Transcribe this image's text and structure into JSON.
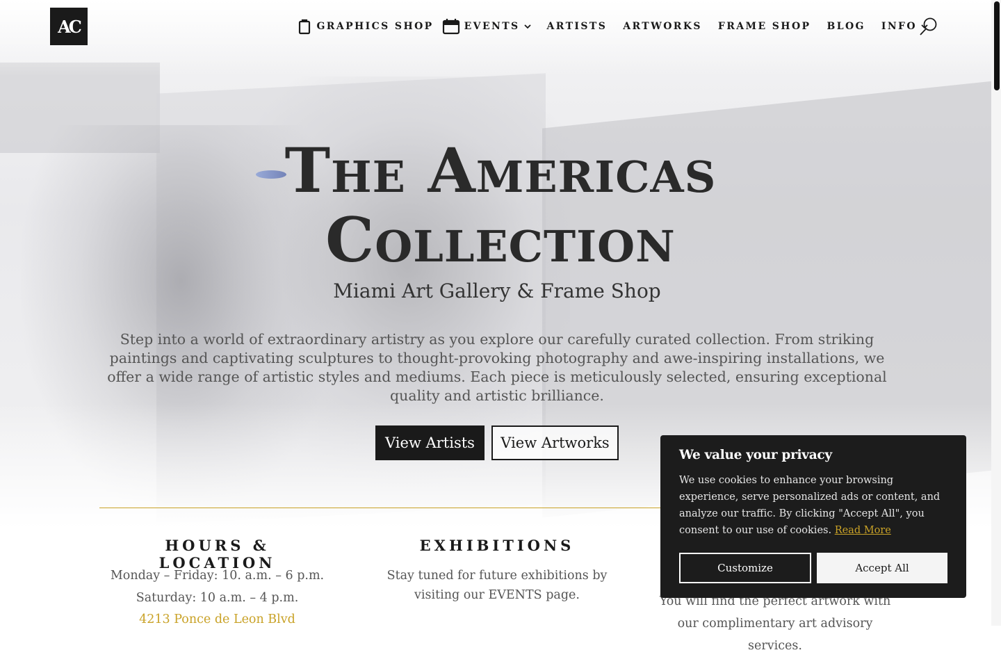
{
  "brand": {
    "logo_text": "AC"
  },
  "nav": {
    "items": [
      {
        "label": "GRAPHICS SHOP",
        "icon": "shopping-bag-icon"
      },
      {
        "label": "EVENTS",
        "icon": "calendar-icon",
        "dropdown": true
      },
      {
        "label": "ARTISTS"
      },
      {
        "label": "ARTWORKS"
      },
      {
        "label": "FRAME SHOP"
      },
      {
        "label": "BLOG"
      },
      {
        "label": "INFO",
        "dropdown": true
      }
    ],
    "search_icon": "search-icon"
  },
  "hero": {
    "title_line1": "The Americas",
    "title_line2": "Collection",
    "subtitle": "Miami Art Gallery & Frame Shop",
    "intro": "Step into a world of extraordinary artistry as you explore our carefully curated collection. From striking paintings and captivating sculptures to thought-provoking photography and awe-inspiring installations, we offer a wide range of artistic styles and mediums. Each piece is meticulously selected, ensuring exceptional quality and artistic brilliance.",
    "btn_artists": "View Artists",
    "btn_artworks": "View Artworks"
  },
  "hours": {
    "title": "HOURS & LOCATION",
    "line1": "Monday – Friday: 10. a.m. – 6 p.m.",
    "line2": "Saturday: 10 a.m. – 4 p.m.",
    "address": "4213 Ponce de Leon Blvd"
  },
  "exhibitions": {
    "title": "EXHIBITIONS",
    "text": "Stay tuned for future exhibitions by visiting our EVENTS page."
  },
  "advisory": {
    "text": "You will find the perfect artwork with our complimentary art advisory services."
  },
  "cookie": {
    "title": "We value your privacy",
    "body": "We use cookies to enhance your browsing experience, serve personalized ads or content, and analyze our traffic. By clicking \"Accept All\", you consent to our use of cookies.",
    "read_more": "Read More",
    "customize": "Customize",
    "accept": "Accept All"
  },
  "colors": {
    "accent_gold": "#c9a227",
    "dark": "#1a1a1a",
    "cookie_bg": "#1c1c1c"
  }
}
